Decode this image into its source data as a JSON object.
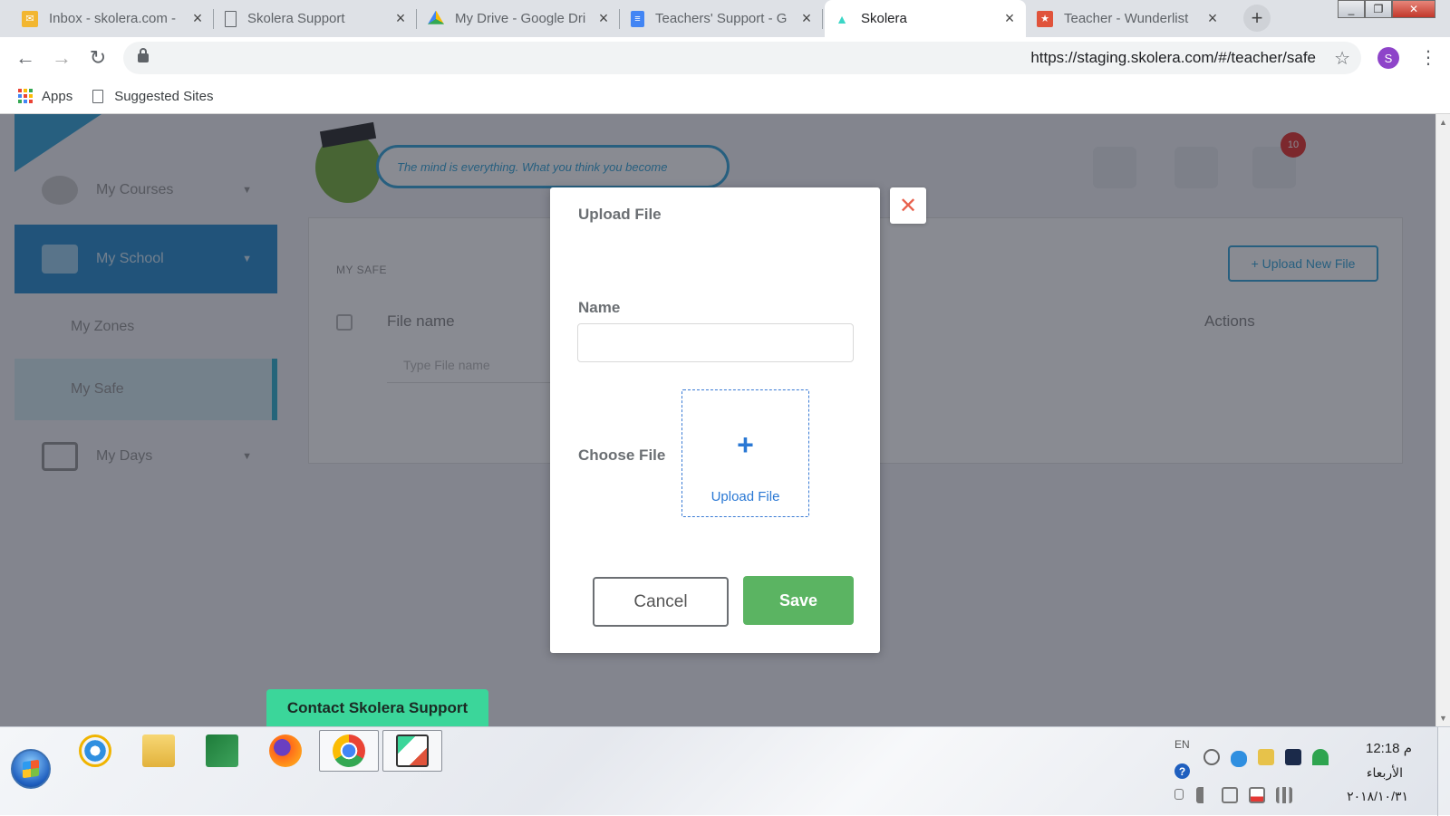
{
  "browser": {
    "tabs": [
      {
        "title": "Inbox - skolera.com -",
        "favicon": "gmail-envelope-icon",
        "color": "#f2b630"
      },
      {
        "title": "Skolera Support",
        "favicon": "document-page-icon",
        "color": "#5f6368"
      },
      {
        "title": "My Drive - Google Dri",
        "favicon": "google-drive-icon",
        "color": "#34a853"
      },
      {
        "title": "Teachers' Support - G",
        "favicon": "google-docs-icon",
        "color": "#4285f4"
      },
      {
        "title": "Skolera",
        "favicon": "skolera-cap-icon",
        "color": "#3bd6c6"
      },
      {
        "title": "Teacher - Wunderlist",
        "favicon": "wunderlist-icon",
        "color": "#e0533b"
      }
    ],
    "active_tab": 4,
    "new_tab": "+",
    "url": "https://staging.skolera.com/#/teacher/safe",
    "profile_initial": "S",
    "profile_color": "#8e44c9",
    "bookmarks": [
      {
        "label": "Apps",
        "icon": "apps-grid-icon"
      },
      {
        "label": "Suggested Sites",
        "icon": "page-icon"
      }
    ]
  },
  "page": {
    "sidebar": [
      {
        "label": "My Courses"
      },
      {
        "label": "My School"
      },
      {
        "label": "My Zones"
      },
      {
        "label": "My Safe"
      },
      {
        "label": "My Days"
      }
    ],
    "quote": "The mind is everything. What you think you become",
    "notification_count": "10",
    "panel": {
      "title": "MY SAFE",
      "upload_button": "+ Upload New File",
      "col_file_name": "File name",
      "col_actions": "Actions",
      "filter_placeholder": "Type File name"
    },
    "accent": "#3aa6d8"
  },
  "modal": {
    "title": "Upload File",
    "name_label": "Name",
    "name_value": "",
    "choose_file_label": "Choose File",
    "dropzone_plus": "+",
    "dropzone_label": "Upload File",
    "cancel_label": "Cancel",
    "save_label": "Save",
    "close_glyph": "✕",
    "save_color": "#5bb462",
    "close_color": "#e8604c"
  },
  "contact_support": "Contact Skolera Support",
  "taskbar": {
    "apps": [
      {
        "name": "internet-explorer-icon",
        "running": false
      },
      {
        "name": "file-explorer-icon",
        "running": false
      },
      {
        "name": "excel-icon",
        "running": false
      },
      {
        "name": "firefox-icon",
        "running": false
      },
      {
        "name": "chrome-icon",
        "running": true
      },
      {
        "name": "skolera-app-icon",
        "running": true
      }
    ],
    "tray": {
      "language": "EN",
      "time": "12:18 م",
      "day": "الأربعاء",
      "date": "٢٠١٨/١٠/٣١"
    }
  }
}
